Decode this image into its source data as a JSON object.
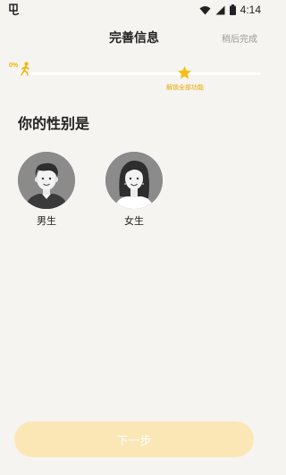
{
  "status_bar": {
    "time": "4:14",
    "icons": [
      "app-icon",
      "wifi-icon",
      "signal-icon",
      "battery-icon"
    ]
  },
  "header": {
    "title": "完善信息",
    "skip_label": "稍后完成"
  },
  "progress": {
    "percent_label": "0%",
    "milestone_label": "解锁全部功能",
    "accent_color": "#f0b400"
  },
  "question": {
    "title": "你的性别是"
  },
  "options": [
    {
      "label": "男生",
      "icon": "male-avatar"
    },
    {
      "label": "女生",
      "icon": "female-avatar"
    }
  ],
  "footer": {
    "next_label": "下一步",
    "button_color": "#fbe7b6"
  }
}
